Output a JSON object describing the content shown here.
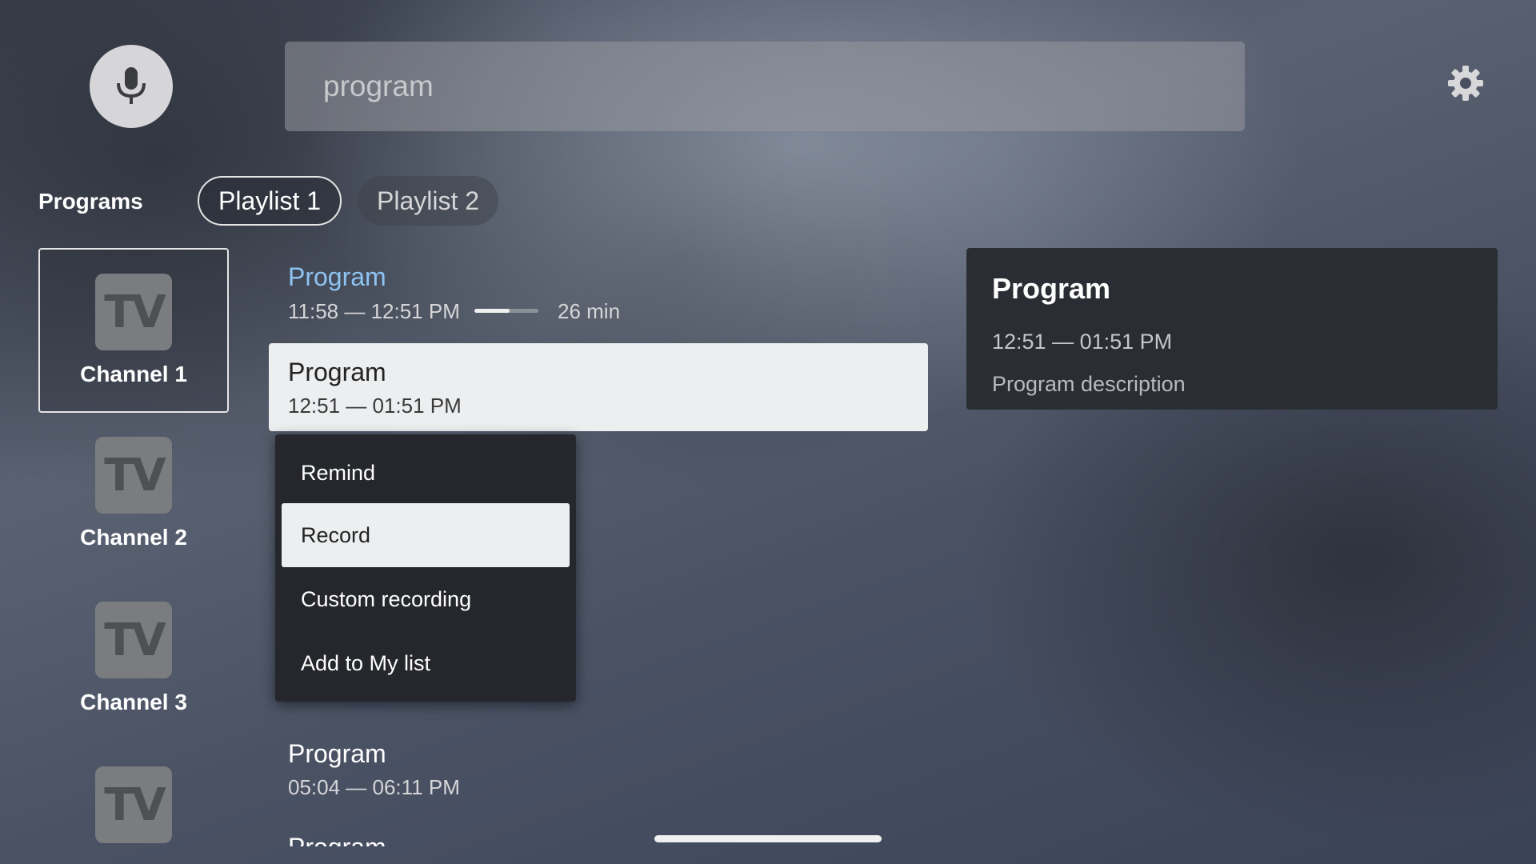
{
  "search": {
    "query": "program",
    "mic_icon": "microphone-icon",
    "settings_icon": "gear-icon"
  },
  "nav": {
    "label": "Programs",
    "playlists": [
      {
        "label": "Playlist 1",
        "selected": true
      },
      {
        "label": "Playlist 2",
        "selected": false
      }
    ]
  },
  "channels": [
    {
      "logo": "TV",
      "name": "Channel 1",
      "selected": true
    },
    {
      "logo": "TV",
      "name": "Channel 2",
      "selected": false
    },
    {
      "logo": "TV",
      "name": "Channel 3",
      "selected": false
    },
    {
      "logo": "TV",
      "name": "",
      "selected": false
    }
  ],
  "programs": [
    {
      "title": "Program",
      "time": "11:58 — 12:51 PM",
      "remaining": "26 min",
      "progress": 0.55,
      "title_color": "#8ec3f2"
    },
    {
      "title": "Program",
      "time": "12:51 — 01:51 PM"
    },
    {
      "title": "Program",
      "time": "05:04 — 06:11 PM"
    },
    {
      "title": "Program"
    }
  ],
  "context_menu": {
    "items": [
      {
        "label": "Remind",
        "focused": false
      },
      {
        "label": "Record",
        "focused": true
      },
      {
        "label": "Custom recording",
        "focused": false
      },
      {
        "label": "Add to My list",
        "focused": false
      }
    ]
  },
  "details": {
    "title": "Program",
    "time": "12:51 — 01:51 PM",
    "description": "Program description"
  },
  "colors": {
    "accent_blue": "#8ec3f2",
    "panel": "#25272c",
    "focus": "#eceef0"
  }
}
